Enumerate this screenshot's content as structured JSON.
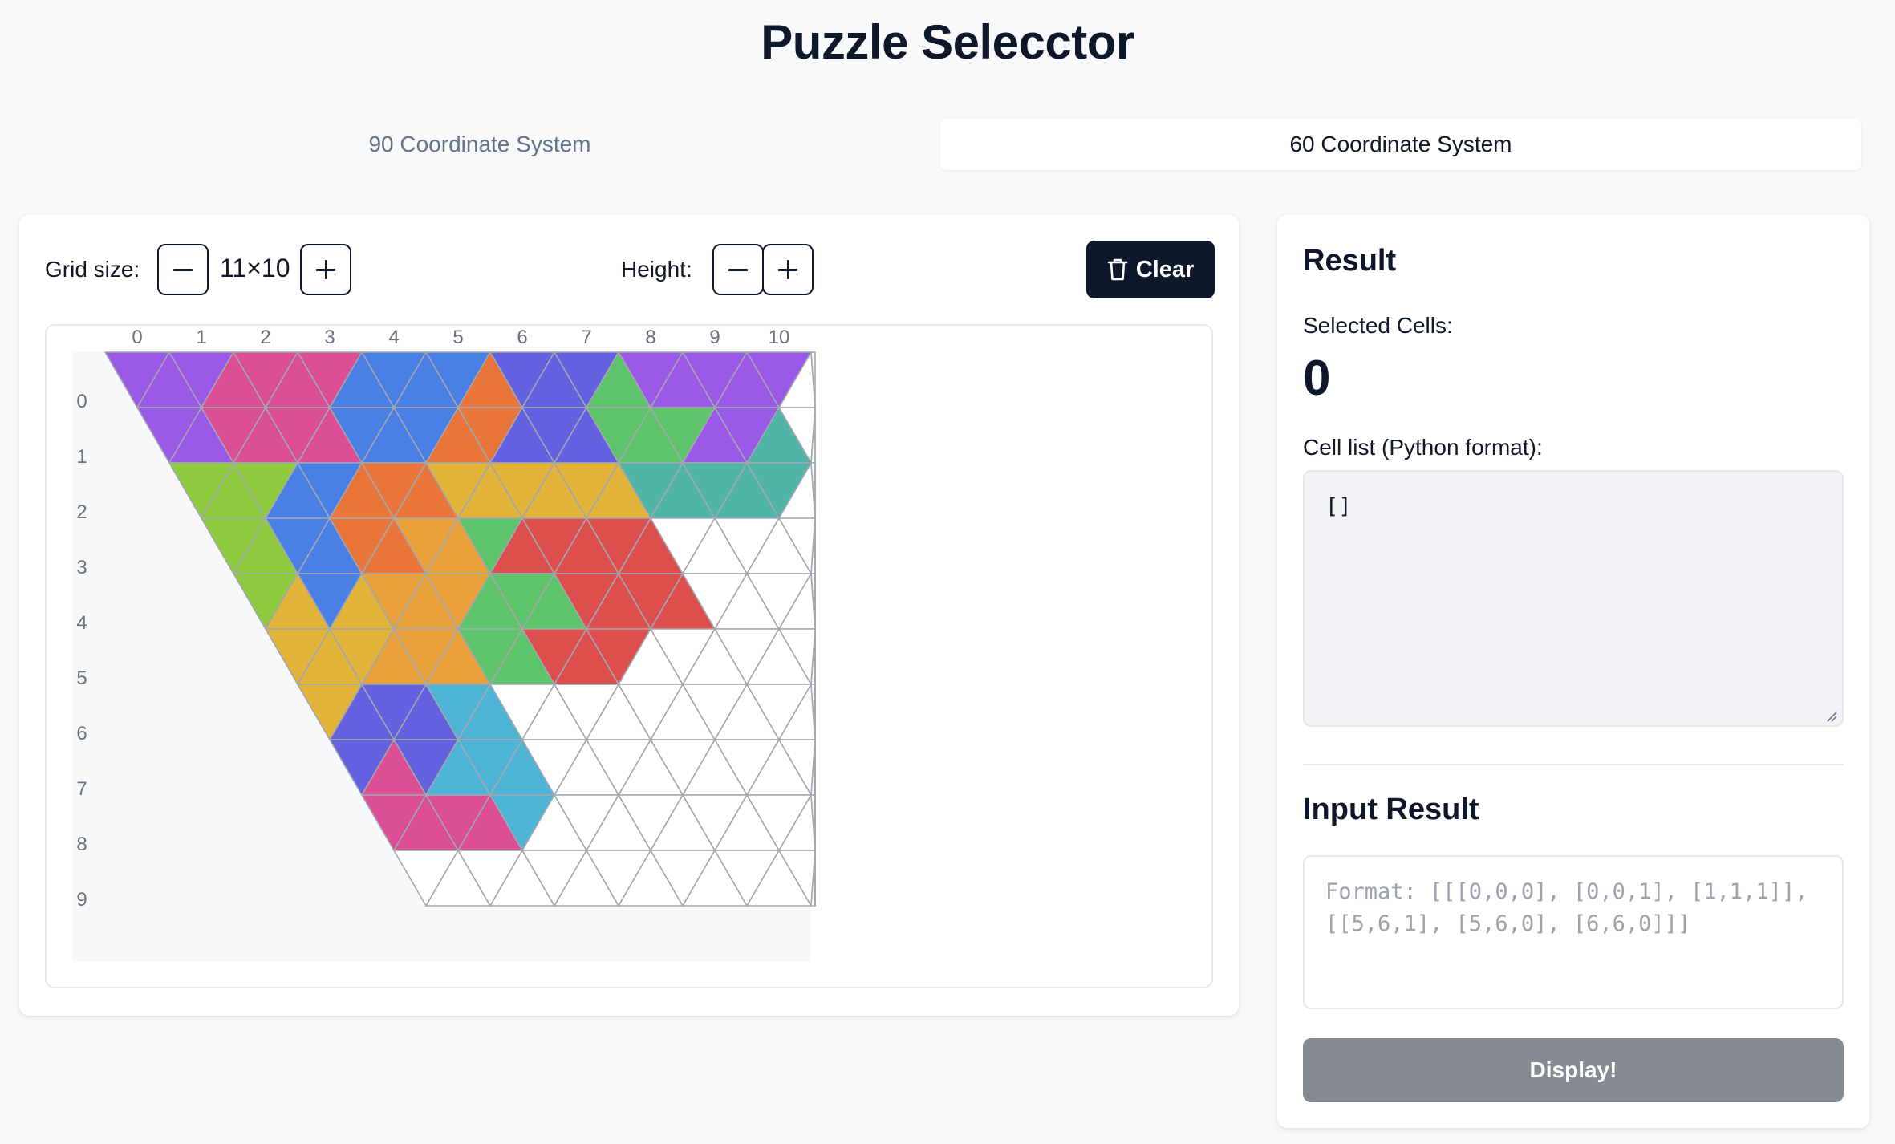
{
  "title": "Puzzle Selecctor",
  "tabs": [
    {
      "label": "90 Coordinate System",
      "active": false
    },
    {
      "label": "60 Coordinate System",
      "active": true
    }
  ],
  "controls": {
    "grid_size_label": "Grid size:",
    "grid_size_value": "11×10",
    "height_label": "Height:",
    "clear_label": "Clear"
  },
  "grid": {
    "columns": 11,
    "rows": 10,
    "col_labels": [
      "0",
      "1",
      "2",
      "3",
      "4",
      "5",
      "6",
      "7",
      "8",
      "9",
      "10"
    ],
    "row_labels": [
      "0",
      "1",
      "2",
      "3",
      "4",
      "5",
      "6",
      "7",
      "8",
      "9"
    ],
    "colors": {
      "purple": "#9b59e8",
      "pink": "#dc4f96",
      "blue": "#4a7fe6",
      "orange": "#e9753a",
      "indigo": "#6461e0",
      "green": "#5ec46b",
      "lime": "#8fcb3e",
      "yellow": "#e3b43a",
      "amber": "#e9a23b",
      "teal": "#50b5a6",
      "red": "#dd4f4c",
      "cyan": "#4db4d6",
      "empty": "#ffffff",
      "stroke": "#a3a7b0"
    },
    "cells": [
      [
        "purple",
        "purple",
        "purple",
        "pink",
        "pink",
        "pink",
        "pink",
        "blue",
        "blue",
        "blue",
        "blue",
        "orange",
        "indigo",
        "indigo",
        "indigo",
        "green",
        "purple",
        "purple",
        "purple",
        "purple",
        "purple",
        "empty",
        "empty"
      ],
      [
        "purple",
        "purple",
        "pink",
        "pink",
        "pink",
        "pink",
        "blue",
        "blue",
        "blue",
        "orange",
        "orange",
        "indigo",
        "indigo",
        "indigo",
        "green",
        "green",
        "green",
        "purple",
        "purple",
        "teal",
        "empty",
        "empty",
        "empty"
      ],
      [
        "lime",
        "lime",
        "lime",
        "blue",
        "blue",
        "orange",
        "orange",
        "orange",
        "yellow",
        "yellow",
        "yellow",
        "yellow",
        "yellow",
        "yellow",
        "teal",
        "teal",
        "teal",
        "teal",
        "teal",
        "empty",
        "empty",
        "empty",
        "empty"
      ],
      [
        "lime",
        "lime",
        "blue",
        "blue",
        "orange",
        "orange",
        "amber",
        "amber",
        "green",
        "red",
        "red",
        "red",
        "red",
        "red",
        "empty",
        "empty",
        "empty",
        "empty",
        "empty",
        "empty",
        "empty",
        "empty",
        "empty"
      ],
      [
        "lime",
        "yellow",
        "blue",
        "yellow",
        "amber",
        "amber",
        "amber",
        "green",
        "green",
        "green",
        "red",
        "red",
        "red",
        "red",
        "empty",
        "empty",
        "empty",
        "empty",
        "empty",
        "empty",
        "empty",
        "empty",
        "empty"
      ],
      [
        "yellow",
        "yellow",
        "yellow",
        "amber",
        "amber",
        "amber",
        "green",
        "green",
        "red",
        "red",
        "red",
        "empty",
        "empty",
        "empty",
        "empty",
        "empty",
        "empty",
        "empty",
        "empty",
        "empty",
        "empty",
        "empty",
        "empty"
      ],
      [
        "yellow",
        "indigo",
        "indigo",
        "indigo",
        "cyan",
        "cyan",
        "empty",
        "empty",
        "empty",
        "empty",
        "empty",
        "empty",
        "empty",
        "empty",
        "empty",
        "empty",
        "empty",
        "empty",
        "empty",
        "empty",
        "empty",
        "empty",
        "empty"
      ],
      [
        "indigo",
        "pink",
        "indigo",
        "cyan",
        "cyan",
        "cyan",
        "empty",
        "empty",
        "empty",
        "empty",
        "empty",
        "empty",
        "empty",
        "empty",
        "empty",
        "empty",
        "empty",
        "empty",
        "empty",
        "empty",
        "empty",
        "empty",
        "empty"
      ],
      [
        "pink",
        "pink",
        "pink",
        "pink",
        "cyan",
        "empty",
        "empty",
        "empty",
        "empty",
        "empty",
        "empty",
        "empty",
        "empty",
        "empty",
        "empty",
        "empty",
        "empty",
        "empty",
        "empty",
        "empty",
        "empty",
        "empty",
        "empty"
      ],
      [
        "empty",
        "empty",
        "empty",
        "empty",
        "empty",
        "empty",
        "empty",
        "empty",
        "empty",
        "empty",
        "empty",
        "empty",
        "empty",
        "empty",
        "empty",
        "empty",
        "empty",
        "empty",
        "empty",
        "empty",
        "empty",
        "empty",
        "empty"
      ]
    ]
  },
  "result": {
    "heading": "Result",
    "selected_label": "Selected Cells:",
    "selected_count": "0",
    "cell_list_label": "Cell list (Python format):",
    "cell_list_value": "[]",
    "input_heading": "Input Result",
    "input_placeholder": "Format: [[[0,0,0], [0,0,1], [1,1,1]], [[5,6,1], [5,6,0], [6,6,0]]]",
    "display_label": "Display!"
  }
}
